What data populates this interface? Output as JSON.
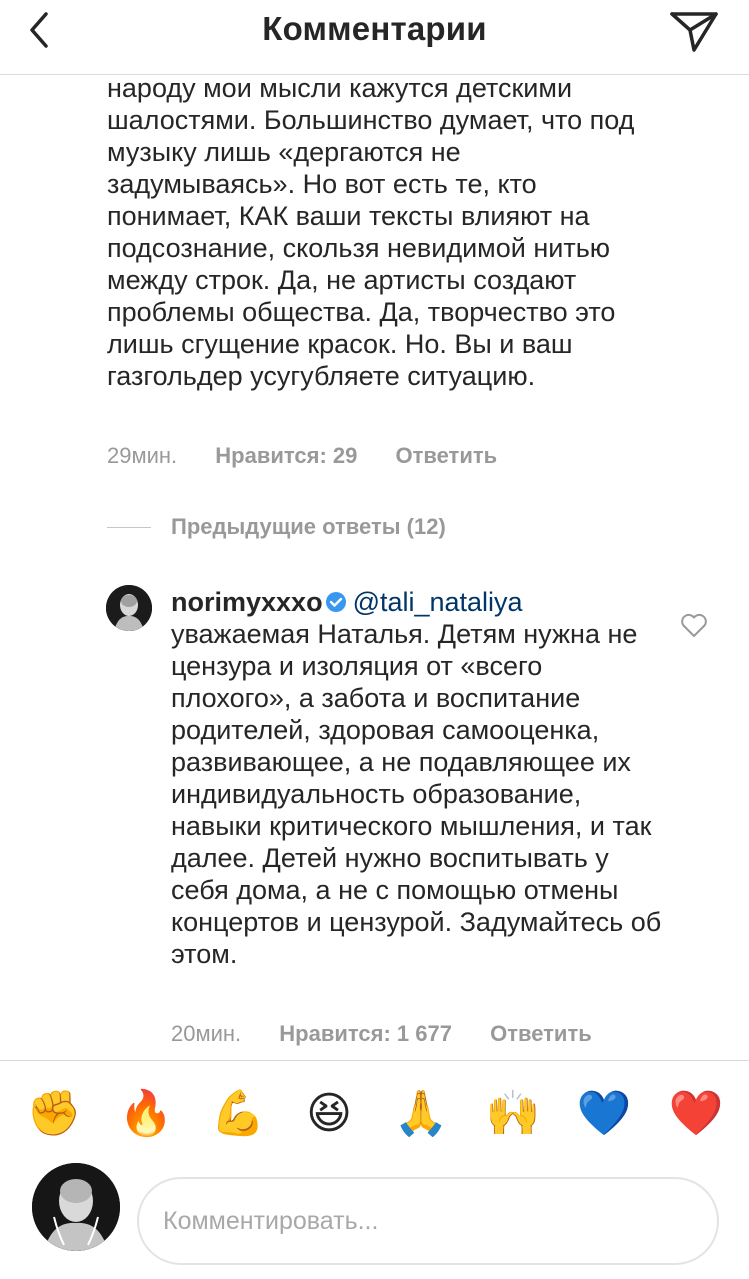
{
  "header": {
    "title": "Комментарии"
  },
  "comments": [
    {
      "text": "народу мои мысли кажутся детскими шалостями. Большинство думает, что под музыку лишь «дергаются не задумываясь». Но вот есть те, кто понимает, КАК ваши тексты влияют на подсознание, скользя невидимой нитью между строк. Да, не артисты создают проблемы общества. Да, творчество это лишь сгущение красок. Но. Вы и ваш газгольдер усугубляете ситуацию.",
      "time": "29мин.",
      "likes": "Нравится: 29",
      "reply": "Ответить"
    },
    {
      "username": "norimyxxxo",
      "mention": "@tali_nataliya",
      "text": "уважаемая Наталья. Детям нужна не цензура и изоляция от «всего плохого», а забота и воспитание родителей, здоровая самооценка, развивающее, а не подавляющее их индивидуальность образование, навыки критического мышления, и так далее. Детей нужно воспитывать у себя дома, а не с помощью отмены концертов и цензурой. Задумайтесь об этом.",
      "time": "20мин.",
      "likes": "Нравится: 1 677",
      "reply": "Ответить"
    }
  ],
  "previous_replies": "Предыдущие ответы (12)",
  "emoji_bar": [
    "✊",
    "🔥",
    "💪",
    "😆",
    "🙏",
    "🙌",
    "💙",
    "❤️"
  ],
  "input": {
    "placeholder": "Комментировать..."
  },
  "colors": {
    "text": "#262626",
    "meta": "#999999",
    "mention": "#003569",
    "verified": "#3897f0",
    "divider": "#dbdbdb"
  },
  "icons": {
    "back": "chevron-left-icon",
    "share": "paper-plane-icon",
    "verified": "verified-badge-icon",
    "like": "heart-outline-icon"
  }
}
